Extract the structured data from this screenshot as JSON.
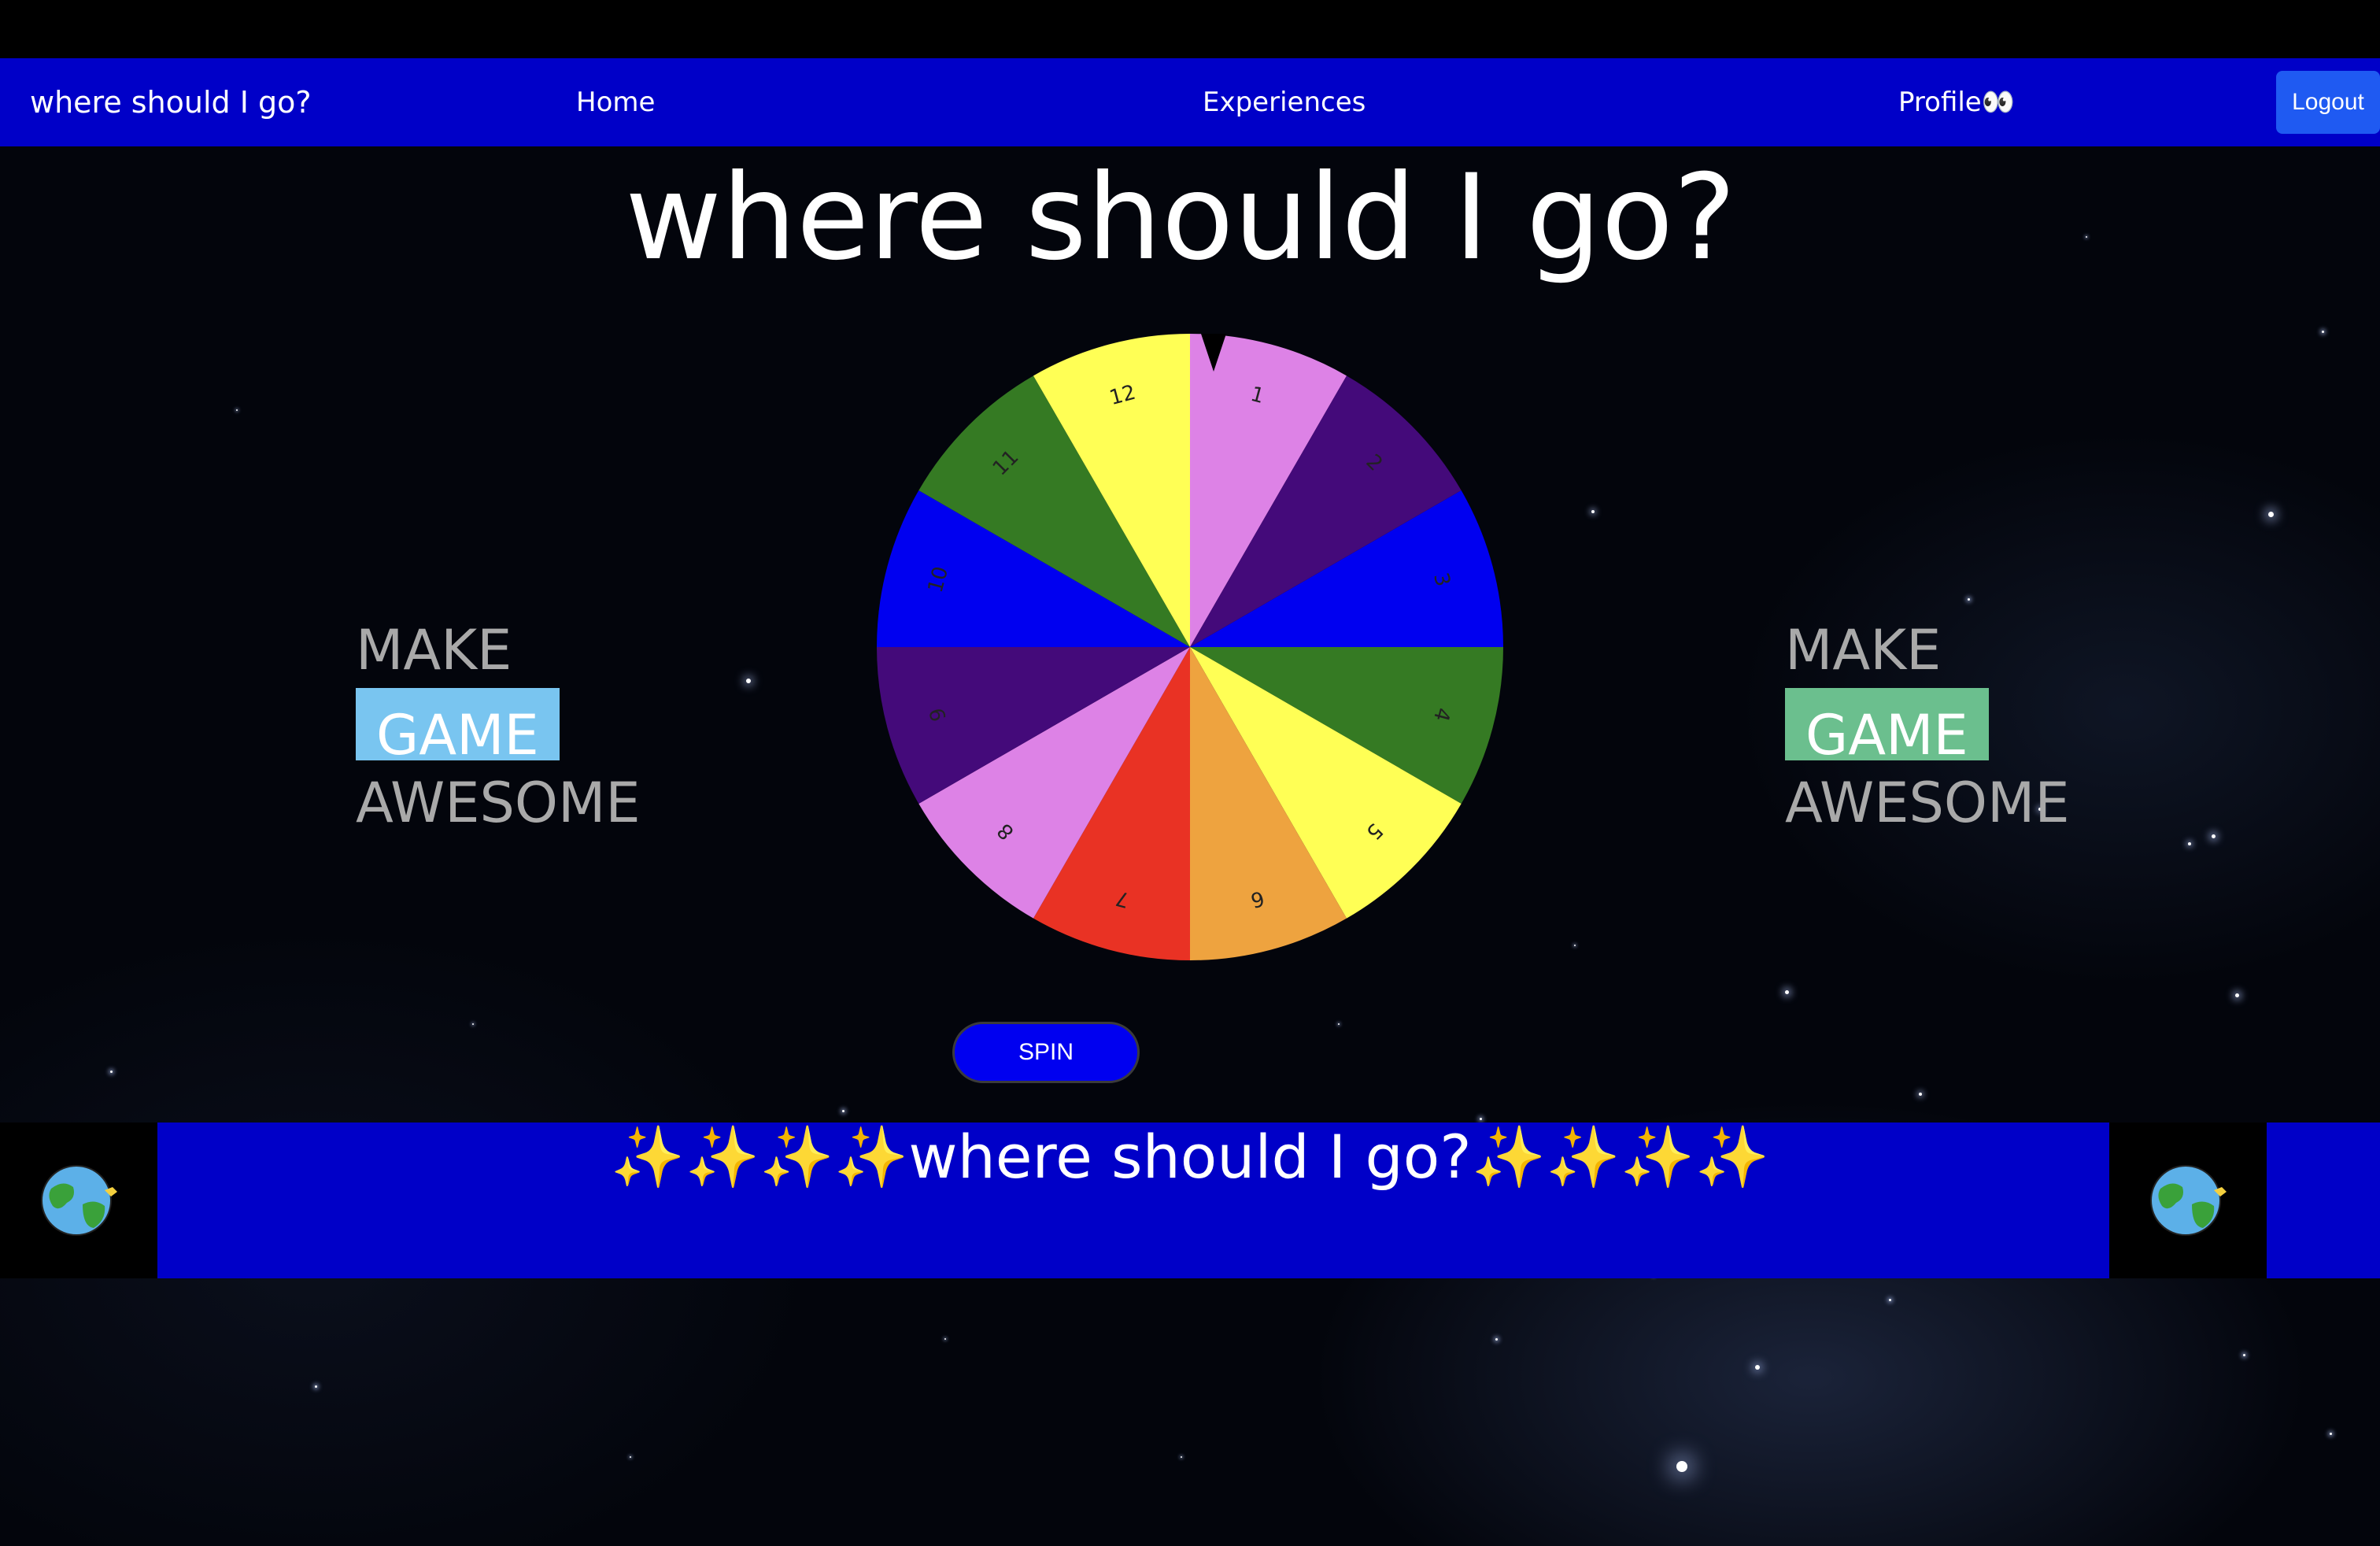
{
  "nav": {
    "brand": "where should I go?",
    "home": "Home",
    "experiences": "Experiences",
    "profile": "Profile👀",
    "logout": "Logout"
  },
  "hero": {
    "title": "where should I go?"
  },
  "wheel": {
    "segments": [
      {
        "label": "1",
        "color": "#dd82e6"
      },
      {
        "label": "2",
        "color": "#440a7a"
      },
      {
        "label": "3",
        "color": "#0000f0"
      },
      {
        "label": "4",
        "color": "#357a23"
      },
      {
        "label": "5",
        "color": "#ffff55"
      },
      {
        "label": "6",
        "color": "#eea33f"
      },
      {
        "label": "7",
        "color": "#e93224"
      },
      {
        "label": "8",
        "color": "#dd82e6"
      },
      {
        "label": "9",
        "color": "#440a7a"
      },
      {
        "label": "10",
        "color": "#0000f0"
      },
      {
        "label": "11",
        "color": "#357a23"
      },
      {
        "label": "12",
        "color": "#ffff55"
      }
    ]
  },
  "side_left": {
    "make": "MAKE",
    "game": "GAME",
    "awesome": "AWESOME",
    "game_bg": "#79c5f0"
  },
  "side_right": {
    "make": "MAKE",
    "game": "GAME",
    "awesome": "AWESOME",
    "game_bg": "#6bbf8e"
  },
  "spin": {
    "label": "SPIN"
  },
  "footer": {
    "sparkles_left": "✨✨✨✨",
    "text": "where should I go?",
    "sparkles_right": "✨✨✨✨"
  },
  "icons": {
    "globe": "globe-icon",
    "pointer": "pointer-icon"
  }
}
